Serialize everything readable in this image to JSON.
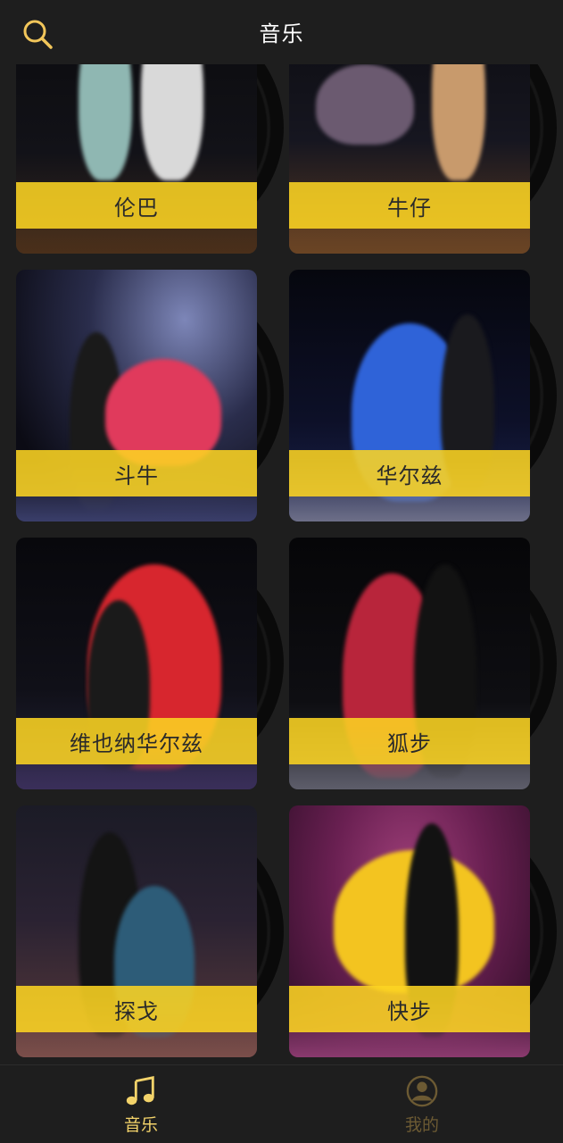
{
  "header": {
    "title": "音乐",
    "search_icon": "search-icon"
  },
  "colors": {
    "accent_gold": "#f2c65a",
    "label_band": "#fcd422",
    "background": "#1e1e1e"
  },
  "dances": [
    {
      "label": "伦巴"
    },
    {
      "label": "牛仔"
    },
    {
      "label": "斗牛"
    },
    {
      "label": "华尔兹"
    },
    {
      "label": "维也纳华尔兹"
    },
    {
      "label": "狐步"
    },
    {
      "label": "探戈"
    },
    {
      "label": "快步"
    }
  ],
  "bottom_nav": {
    "music": {
      "label": "音乐",
      "icon": "music-note-icon",
      "active": true
    },
    "mine": {
      "label": "我的",
      "icon": "user-icon",
      "active": false
    }
  }
}
